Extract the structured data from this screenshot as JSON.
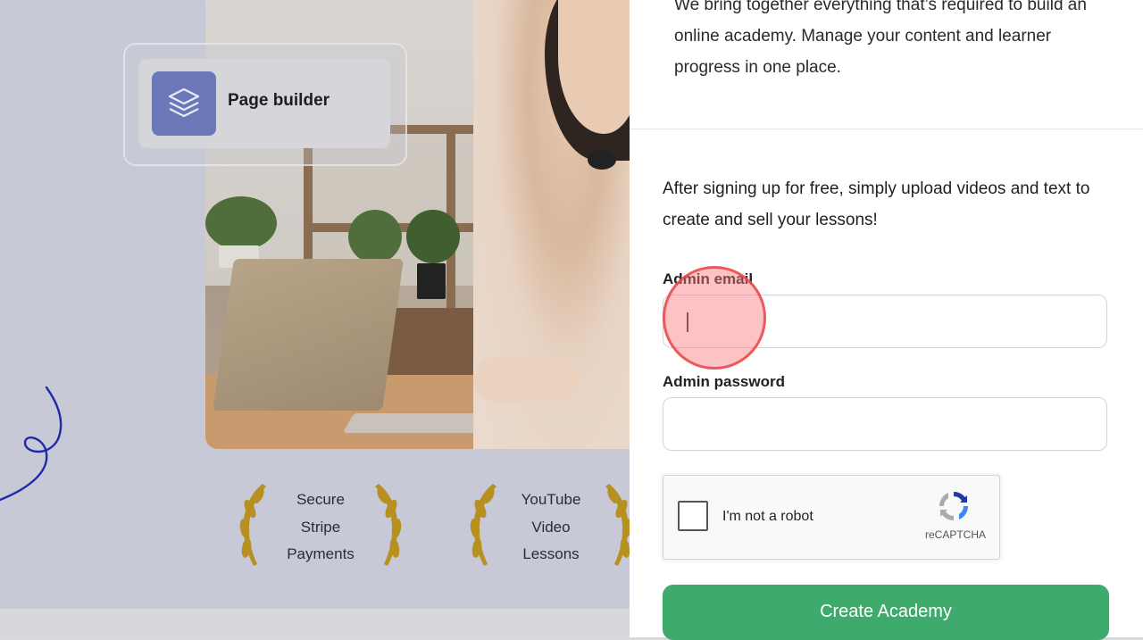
{
  "background_page": {
    "feature_card": {
      "label": "Page builder",
      "icon": "layers-icon"
    },
    "badges": [
      {
        "lines": [
          "Secure",
          "Stripe",
          "Payments"
        ],
        "icon": "laurel-wreath-icon"
      },
      {
        "lines": [
          "YouTube",
          "Video",
          "Lessons"
        ],
        "icon": "laurel-wreath-icon"
      }
    ]
  },
  "panel": {
    "intro_text": "We bring together everything that’s required to build an online academy. Manage your content and learner progress in one place.",
    "lead_text": "After signing up for free, simply upload videos and text to create and sell your lessons!",
    "email": {
      "label": "Admin email",
      "value": ""
    },
    "password": {
      "label": "Admin password",
      "value": ""
    },
    "recaptcha": {
      "label": "I'm not a robot",
      "brand": "reCAPTCHA"
    },
    "submit_label": "Create Academy"
  },
  "colors": {
    "accent_green": "#3eaa6b",
    "card_icon_bg": "#6a78b8",
    "laurel_gold": "#b8901f",
    "squiggle_blue": "#1f2aa8"
  }
}
